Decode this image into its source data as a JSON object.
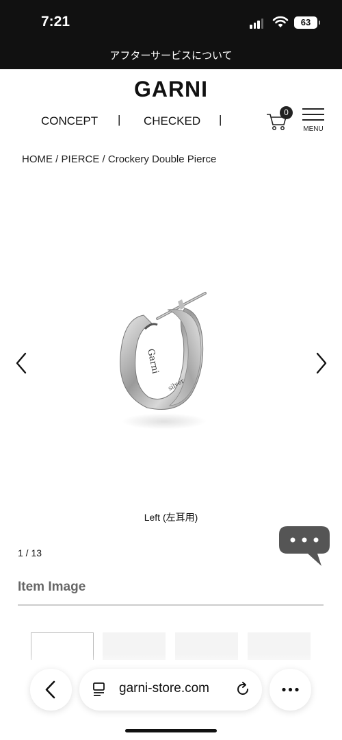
{
  "status": {
    "time": "7:21",
    "battery": "63"
  },
  "announcement": "アフターサービスについて",
  "header": {
    "logo": "GARNI",
    "nav": [
      "CONCEPT",
      "CHECKED"
    ],
    "separator": "|",
    "cart_count": "0",
    "menu_label": "MENU"
  },
  "breadcrumb": {
    "home": "HOME",
    "category": "PIERCE",
    "product": "Crockery Double Pierce",
    "sep": " / "
  },
  "gallery": {
    "caption": "Left (左耳用)",
    "counter": "1 / 13"
  },
  "section": {
    "title": "Item Image"
  },
  "browser": {
    "url": "garni-store.com"
  },
  "icons": [
    "chevron-left-icon",
    "chevron-right-icon",
    "cart-icon",
    "hamburger-icon",
    "chat-icon",
    "tabs-icon",
    "reload-icon",
    "more-icon",
    "back-icon"
  ]
}
